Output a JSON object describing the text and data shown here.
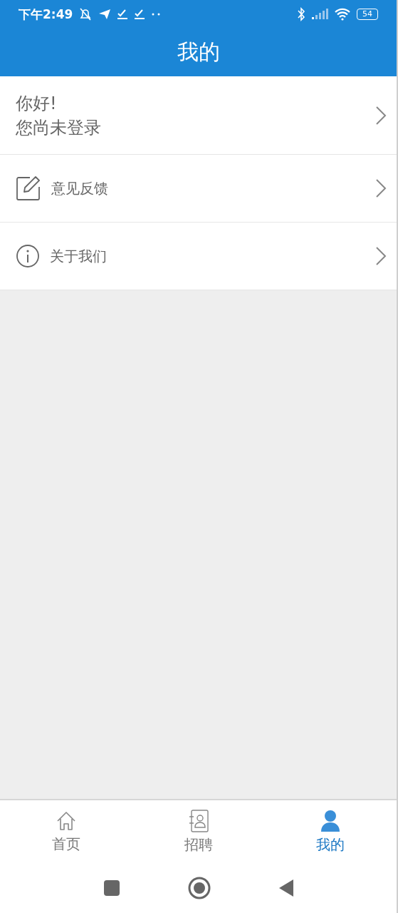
{
  "status_bar": {
    "time": "下午2:49",
    "battery": "54"
  },
  "header": {
    "title": "我的"
  },
  "profile": {
    "greeting": "你好!",
    "status": "您尚未登录"
  },
  "menu": [
    {
      "kind": "feedback",
      "label": "意见反馈"
    },
    {
      "kind": "about",
      "label": "关于我们"
    }
  ],
  "tabs": [
    {
      "kind": "home",
      "label": "首页",
      "selected": false
    },
    {
      "kind": "contacts",
      "label": "招聘",
      "selected": false
    },
    {
      "kind": "person",
      "label": "我的",
      "selected": true
    }
  ]
}
